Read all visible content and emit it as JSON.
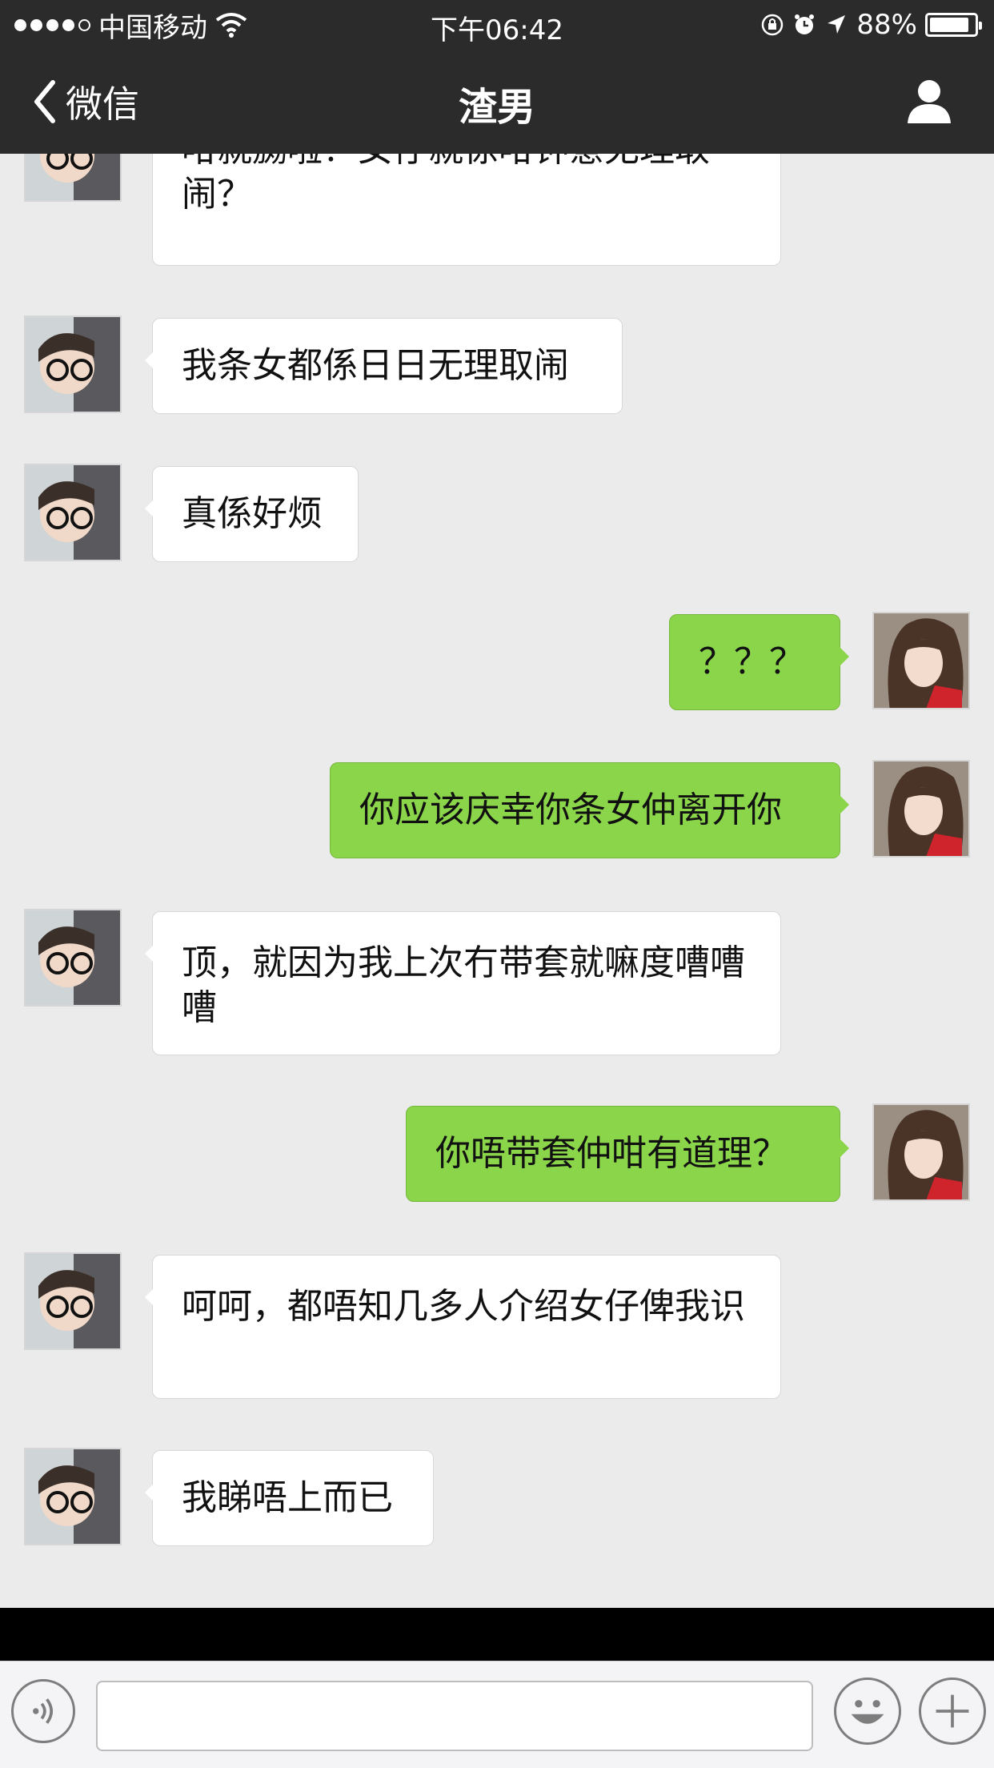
{
  "status_bar": {
    "carrier": "中国移动",
    "time": "下午06:42",
    "battery_percent": "88%",
    "battery_level": 0.88
  },
  "nav": {
    "back_label": "微信",
    "title": "渣男"
  },
  "messages": [
    {
      "side": "in",
      "text": "咁就嬲啦？女仔就係咁钟意无理取闹？"
    },
    {
      "side": "in",
      "text": "我条女都係日日无理取闹"
    },
    {
      "side": "in",
      "text": "真係好烦"
    },
    {
      "side": "out",
      "text": "？？？"
    },
    {
      "side": "out",
      "text": "你应该庆幸你条女仲离开你"
    },
    {
      "side": "in",
      "text": "顶，就因为我上次冇带套就嘛度嘈嘈嘈"
    },
    {
      "side": "out",
      "text": "你唔带套仲咁有道理？"
    },
    {
      "side": "in",
      "text": "呵呵，都唔知几多人介绍女仔俾我识"
    },
    {
      "side": "in",
      "text": "我睇唔上而已"
    }
  ],
  "colors": {
    "bar_bg": "#2b2b2b",
    "chat_bg": "#ebebeb",
    "incoming_bubble": "#ffffff",
    "outgoing_bubble": "#8bd54a"
  },
  "icons": {
    "back": "chevron-left-icon",
    "profile": "person-icon",
    "voice": "voice-icon",
    "emoji": "smiley-icon",
    "plus": "plus-icon"
  }
}
